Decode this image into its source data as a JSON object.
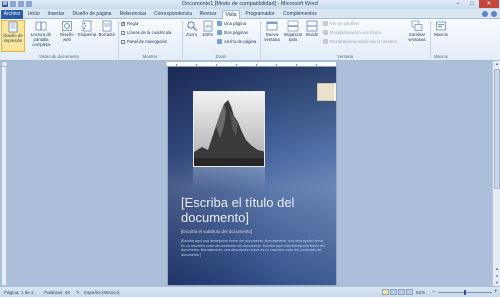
{
  "window": {
    "title": "Documento1 [Modo de compatibilidad] - Microsoft Word",
    "minimize": "–",
    "maximize": "□",
    "close": "✕",
    "app_logo": "W"
  },
  "tabs": [
    "Archivo",
    "Inicio",
    "Insertar",
    "Diseño de página",
    "Referencias",
    "Correspondencia",
    "Revisar",
    "Vista",
    "Programador",
    "Complementos"
  ],
  "active_tab": "Vista",
  "ribbon": {
    "groups": {
      "document_views": {
        "label": "Vistas de documento",
        "buttons": [
          "Diseño de impresión",
          "Lectura de pantalla completa",
          "Diseño web",
          "Esquema",
          "Borrador"
        ]
      },
      "show": {
        "label": "Mostrar",
        "checks": [
          {
            "label": "Regla",
            "checked": true
          },
          {
            "label": "Líneas de la cuadrícula",
            "checked": false
          },
          {
            "label": "Panel de navegación",
            "checked": false
          }
        ]
      },
      "zoom": {
        "label": "Zoom",
        "zoom_button": "Zoom",
        "percent_button": "100%",
        "small": [
          "Una página",
          "Dos páginas",
          "Ancho de página"
        ]
      },
      "window": {
        "label": "Ventana",
        "buttons": [
          "Nueva ventana",
          "Organizar todo",
          "Dividir"
        ],
        "small": [
          "Ver en paralelo",
          "Desplazamiento sincrónico",
          "Restablecer posición de la ventana"
        ],
        "switch": "Cambiar ventanas"
      },
      "macros": {
        "label": "Macros",
        "button": "Macros"
      }
    }
  },
  "document": {
    "title": "[Escriba el título del documento]",
    "subtitle": "[Escriba el subtítulo del documento]",
    "abstract": "[Escriba aquí una descripción breve del documento. Normalmente, una descripción breve es un resumen corto del contenido del documento. Escriba aquí una descripción breve del documento. Normalmente, una descripción breve es un resumen corto del contenido del documento.]"
  },
  "status": {
    "page": "Página: 1 de 2",
    "words": "Palabras: 48",
    "language": "Español (México)",
    "zoom": "52%",
    "minus": "−",
    "plus": "+"
  },
  "colors": {
    "file_tab": "#2a5ba8",
    "page_gradient_start": "#223a70",
    "page_gradient_end": "#4a6ca6",
    "selected_button": "#fbe59a"
  }
}
